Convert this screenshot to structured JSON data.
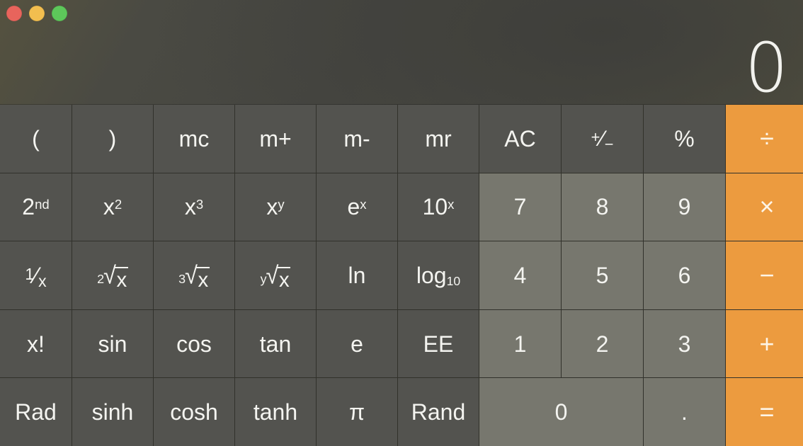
{
  "window": {
    "traffic_lights": [
      {
        "name": "close",
        "color": "#e8645c"
      },
      {
        "name": "minimize",
        "color": "#f2be4f"
      },
      {
        "name": "zoom",
        "color": "#5dc75a"
      }
    ]
  },
  "display": {
    "value": "0"
  },
  "theme": {
    "operator_color": "#ec9b3f",
    "function_key_color": "#565652",
    "number_key_color": "#8a8a80",
    "text_color": "#f4f4f0",
    "display_background": "#4a4a42"
  },
  "keypad": {
    "rows": [
      {
        "keys": [
          {
            "id": "open-paren",
            "label": "(",
            "type": "fn"
          },
          {
            "id": "close-paren",
            "label": ")",
            "type": "fn"
          },
          {
            "id": "mc",
            "label": "mc",
            "type": "fn"
          },
          {
            "id": "m-plus",
            "label": "m+",
            "type": "fn"
          },
          {
            "id": "m-minus",
            "label": "m-",
            "type": "fn"
          },
          {
            "id": "mr",
            "label": "mr",
            "type": "fn"
          },
          {
            "id": "all-clear",
            "label": "AC",
            "type": "fn"
          },
          {
            "id": "sign",
            "label": "+/-",
            "type": "fn",
            "glyph": "plus-minus"
          },
          {
            "id": "percent",
            "label": "%",
            "type": "fn"
          },
          {
            "id": "divide",
            "label": "÷",
            "type": "op"
          }
        ]
      },
      {
        "keys": [
          {
            "id": "second",
            "label": "2nd",
            "type": "fn",
            "base": "2",
            "sup": "nd"
          },
          {
            "id": "x-squared",
            "label": "x2",
            "type": "fn",
            "base": "x",
            "sup": "2"
          },
          {
            "id": "x-cubed",
            "label": "x3",
            "type": "fn",
            "base": "x",
            "sup": "3"
          },
          {
            "id": "x-to-y",
            "label": "xy",
            "type": "fn",
            "base": "x",
            "sup": "y"
          },
          {
            "id": "e-to-x",
            "label": "ex",
            "type": "fn",
            "base": "e",
            "sup": "x"
          },
          {
            "id": "ten-to-x",
            "label": "10x",
            "type": "fn",
            "base": "10",
            "sup": "x"
          },
          {
            "id": "seven",
            "label": "7",
            "type": "num"
          },
          {
            "id": "eight",
            "label": "8",
            "type": "num"
          },
          {
            "id": "nine",
            "label": "9",
            "type": "num"
          },
          {
            "id": "multiply",
            "label": "×",
            "type": "op"
          }
        ]
      },
      {
        "keys": [
          {
            "id": "reciprocal",
            "label": "1/x",
            "type": "fn",
            "glyph": "fraction",
            "numerator": "1",
            "denominator": "x"
          },
          {
            "id": "square-root",
            "label": "2√x",
            "type": "fn",
            "glyph": "radical",
            "index": "2",
            "radicand": "x"
          },
          {
            "id": "cube-root",
            "label": "3√x",
            "type": "fn",
            "glyph": "radical",
            "index": "3",
            "radicand": "x"
          },
          {
            "id": "y-root",
            "label": "y√x",
            "type": "fn",
            "glyph": "radical",
            "index": "y",
            "radicand": "x"
          },
          {
            "id": "natural-log",
            "label": "ln",
            "type": "fn"
          },
          {
            "id": "log-base-10",
            "label": "log10",
            "type": "fn",
            "base": "log",
            "sub": "10"
          },
          {
            "id": "four",
            "label": "4",
            "type": "num"
          },
          {
            "id": "five",
            "label": "5",
            "type": "num"
          },
          {
            "id": "six",
            "label": "6",
            "type": "num"
          },
          {
            "id": "subtract",
            "label": "−",
            "type": "op"
          }
        ]
      },
      {
        "keys": [
          {
            "id": "factorial",
            "label": "x!",
            "type": "fn"
          },
          {
            "id": "sin",
            "label": "sin",
            "type": "fn"
          },
          {
            "id": "cos",
            "label": "cos",
            "type": "fn"
          },
          {
            "id": "tan",
            "label": "tan",
            "type": "fn"
          },
          {
            "id": "euler",
            "label": "e",
            "type": "fn"
          },
          {
            "id": "ee",
            "label": "EE",
            "type": "fn"
          },
          {
            "id": "one",
            "label": "1",
            "type": "num"
          },
          {
            "id": "two",
            "label": "2",
            "type": "num"
          },
          {
            "id": "three",
            "label": "3",
            "type": "num"
          },
          {
            "id": "add",
            "label": "+",
            "type": "op"
          }
        ]
      },
      {
        "keys": [
          {
            "id": "rad",
            "label": "Rad",
            "type": "fn"
          },
          {
            "id": "sinh",
            "label": "sinh",
            "type": "fn"
          },
          {
            "id": "cosh",
            "label": "cosh",
            "type": "fn"
          },
          {
            "id": "tanh",
            "label": "tanh",
            "type": "fn"
          },
          {
            "id": "pi",
            "label": "π",
            "type": "fn"
          },
          {
            "id": "rand",
            "label": "Rand",
            "type": "fn"
          },
          {
            "id": "zero",
            "label": "0",
            "type": "num",
            "span": 2
          },
          {
            "id": "decimal",
            "label": ".",
            "type": "num"
          },
          {
            "id": "equals",
            "label": "=",
            "type": "op"
          }
        ]
      }
    ]
  }
}
